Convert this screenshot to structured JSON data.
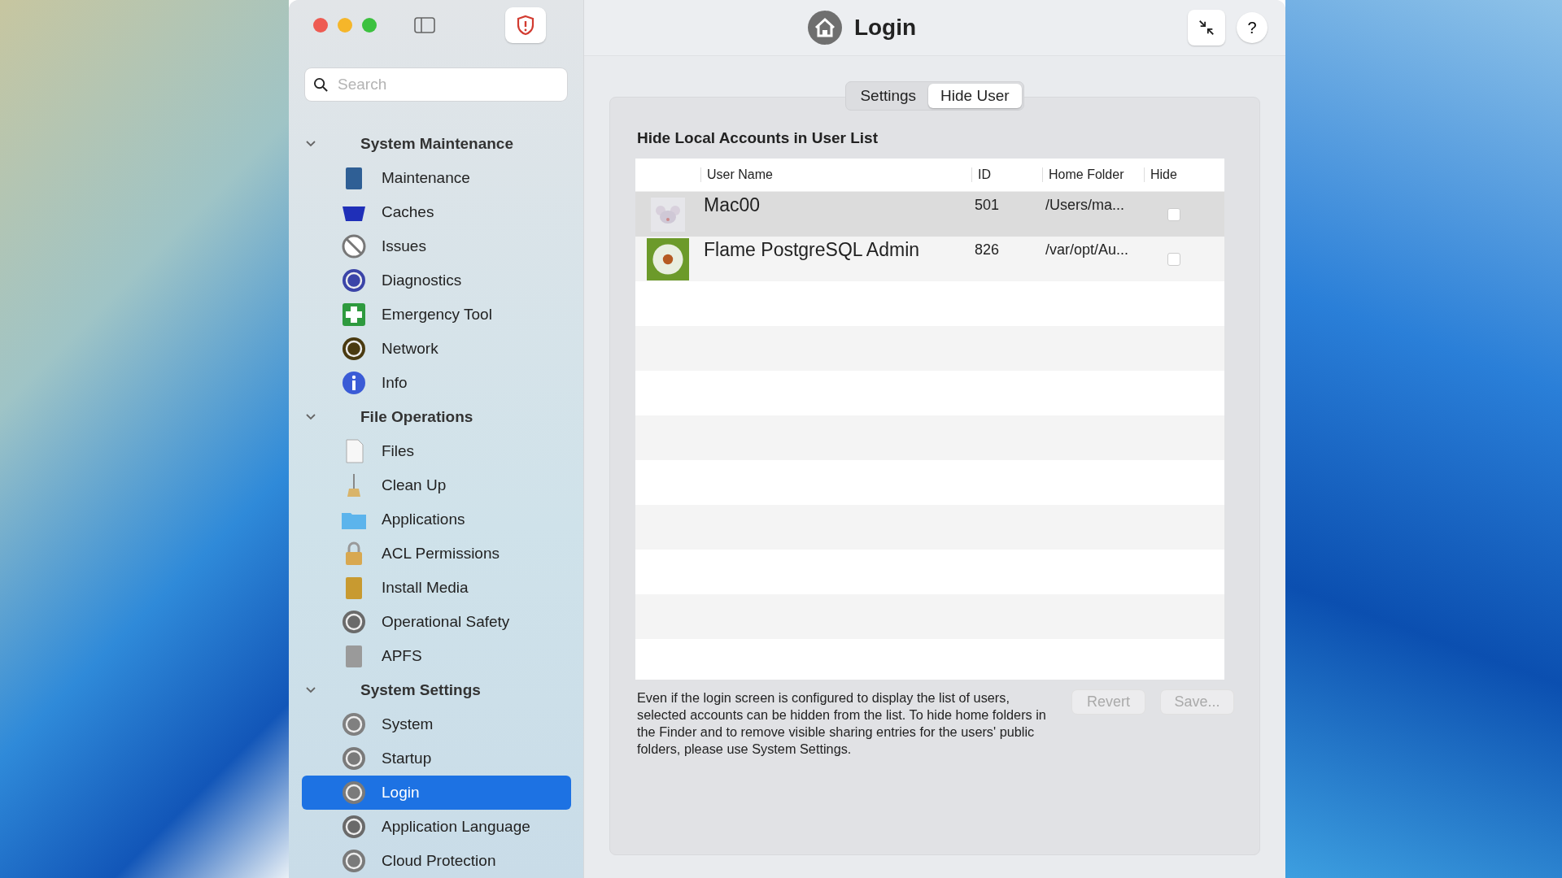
{
  "sidebar": {
    "search": {
      "placeholder": "Search"
    },
    "groups": [
      {
        "title": "System Maintenance",
        "expanded": true,
        "items": [
          {
            "label": "Maintenance",
            "selected": false
          },
          {
            "label": "Caches",
            "selected": false
          },
          {
            "label": "Issues",
            "selected": false
          },
          {
            "label": "Diagnostics",
            "selected": false
          },
          {
            "label": "Emergency Tool",
            "selected": false
          },
          {
            "label": "Network",
            "selected": false
          },
          {
            "label": "Info",
            "selected": false
          }
        ]
      },
      {
        "title": "File Operations",
        "expanded": true,
        "items": [
          {
            "label": "Files",
            "selected": false
          },
          {
            "label": "Clean Up",
            "selected": false
          },
          {
            "label": "Applications",
            "selected": false
          },
          {
            "label": "ACL Permissions",
            "selected": false
          },
          {
            "label": "Install Media",
            "selected": false
          },
          {
            "label": "Operational Safety",
            "selected": false
          },
          {
            "label": "APFS",
            "selected": false
          }
        ]
      },
      {
        "title": "System Settings",
        "expanded": true,
        "items": [
          {
            "label": "System",
            "selected": false
          },
          {
            "label": "Startup",
            "selected": false
          },
          {
            "label": "Login",
            "selected": true
          },
          {
            "label": "Application Language",
            "selected": false
          },
          {
            "label": "Cloud Protection",
            "selected": false
          }
        ]
      }
    ]
  },
  "window": {
    "title": "Login",
    "help": "?"
  },
  "tabs": [
    {
      "label": "Settings",
      "selected": false
    },
    {
      "label": "Hide User",
      "selected": true
    }
  ],
  "section_title": "Hide Local Accounts in User List",
  "table": {
    "columns": [
      "User Name",
      "ID",
      "Home Folder",
      "Hide"
    ],
    "rows": [
      {
        "kind": "mouse",
        "user_name": "Mac00",
        "id": "501",
        "home_folder": "/Users/ma...",
        "hide": false,
        "selected": true
      },
      {
        "kind": "flower",
        "user_name": "Flame PostgreSQL Admin",
        "id": "826",
        "home_folder": "/var/opt/Au...",
        "hide": false,
        "selected": false
      }
    ]
  },
  "footer_text": "Even if the login screen is configured to display the list of users, selected accounts can be hidden from the list. To hide home folders in the Finder and to remove visible sharing entries for the users' public folders, please use System Settings.",
  "buttons": [
    {
      "label": "Revert",
      "disabled": true
    },
    {
      "label": "Save...",
      "disabled": true
    }
  ]
}
